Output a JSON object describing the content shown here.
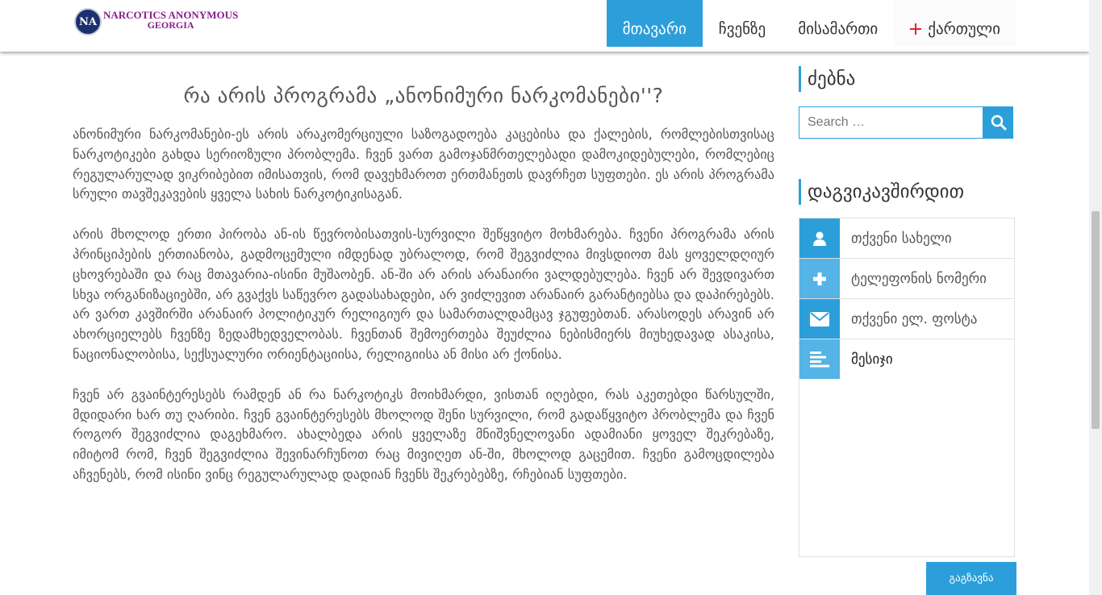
{
  "header": {
    "logo_line1": "NARCOTICS ANONYMOUS",
    "logo_line2": "GEORGIA",
    "logo_mark": "NA",
    "nav": [
      {
        "label": "მთავარი",
        "active": true
      },
      {
        "label": "ჩვენზე",
        "active": false
      },
      {
        "label": "მისამართი",
        "active": false
      },
      {
        "label": "ქართული",
        "icon": "georgian-flag-icon",
        "active": false
      }
    ]
  },
  "article": {
    "title": "რა არის პროგრამა „ანონიმური ნარკომანები''?",
    "paragraphs": [
      "ანონიმური ნარკომანები-ეს არის არაკომერციული საზოგადოება კაცებისა და ქალების, რომლებისთვისაც ნარკოტიკები გახდა სერიოზული პრობლემა. ჩვენ ვართ გამოჯანმრთელებადი დამოკიდებულები, რომლებიც რეგულარულად ვიკრიბებით იმისათვის, რომ დავეხმაროთ ერთმანეთს დავრჩეთ სუფთები. ეს არის პროგრამა სრული თავშეკავების ყველა სახის ნარკოტიკისაგან.",
      "არის მხოლოდ ერთი პირობა ან-ის წევრობისათვის-სურვილი შეწყვიტო მოხმარება. ჩვენი პროგრამა არის პრინციპების ერთიანობა, გადმოცემული იმდენად უბრალოდ, რომ შეგვიძლია მივსდიოთ მას ყოველდღიურ ცხოვრებაში და რაც მთავარია-ისინი მუშაობენ. ან-ში არ არის არანაირი ვალდებულება. ჩვენ არ შევდივართ სხვა ორგანიზაციებში, არ გვაქვს საწევრო გადასახადები, არ ვიძლევით არანაირ გარანტიებსა და დაპირებებს. არ ვართ კავშირში არანაირ პოლიტიკურ რელიგიურ და სამართალდამცავ ჯგუფებთან. არასოდეს არავინ არ ახორციელებს ჩვენზე ზედამხედველობას. ჩვენთან შემოერთება შეუძლია ნებისმიერს მიუხედავად ასაკისა, ნაციონალობისა, სექსუალური ორიენტაციისა, რელიგიისა ან მისი არ ქონისა.",
      "ჩვენ არ გვაინტერესებს რამდენ ან რა ნარკოტიკს მოიხმარდი, ვისთან იღებდი, რას აკეთებდი წარსულში, მდიდარი ხარ თუ ღარიბი. ჩვენ გვაინტერესებს მხოლოდ შენი სურვილი, რომ გადაწყვიტო პრობლემა და ჩვენ როგორ შეგვიძლია დაგეხმარო. ახალბედა არის ყველაზე მნიშვნელოვანი ადამიანი ყოველ შეკრებაზე, იმიტომ რომ, ჩვენ შეგვიძლია შევინარჩუნოთ რაც მივიღეთ ან-ში, მხოლოდ გაცემით. ჩვენი გამოცდილება აჩვენებს, რომ ისინი ვინც რეგულარულად დადიან ჩვენს შეკრებებზე, რჩებიან სუფთები."
    ]
  },
  "sidebar": {
    "search_title": "ძებნა",
    "search_placeholder": "Search …",
    "contact_title": "დაგვიკავშირდით",
    "fields": [
      {
        "label": "თქვენი სახელი",
        "icon": "user-icon"
      },
      {
        "label": "ტელეფონის ნომერი",
        "icon": "plus-icon"
      },
      {
        "label": "თქვენი ელ. ფოსტა",
        "icon": "envelope-icon"
      },
      {
        "label": "მესიჯი",
        "icon": "align-left-icon"
      }
    ],
    "send_label": "გაგზავნა"
  },
  "colors": {
    "accent": "#2c9fdb",
    "accent_light": "#55b3e6",
    "logo_text": "#8a1c8e",
    "text": "#555555"
  }
}
